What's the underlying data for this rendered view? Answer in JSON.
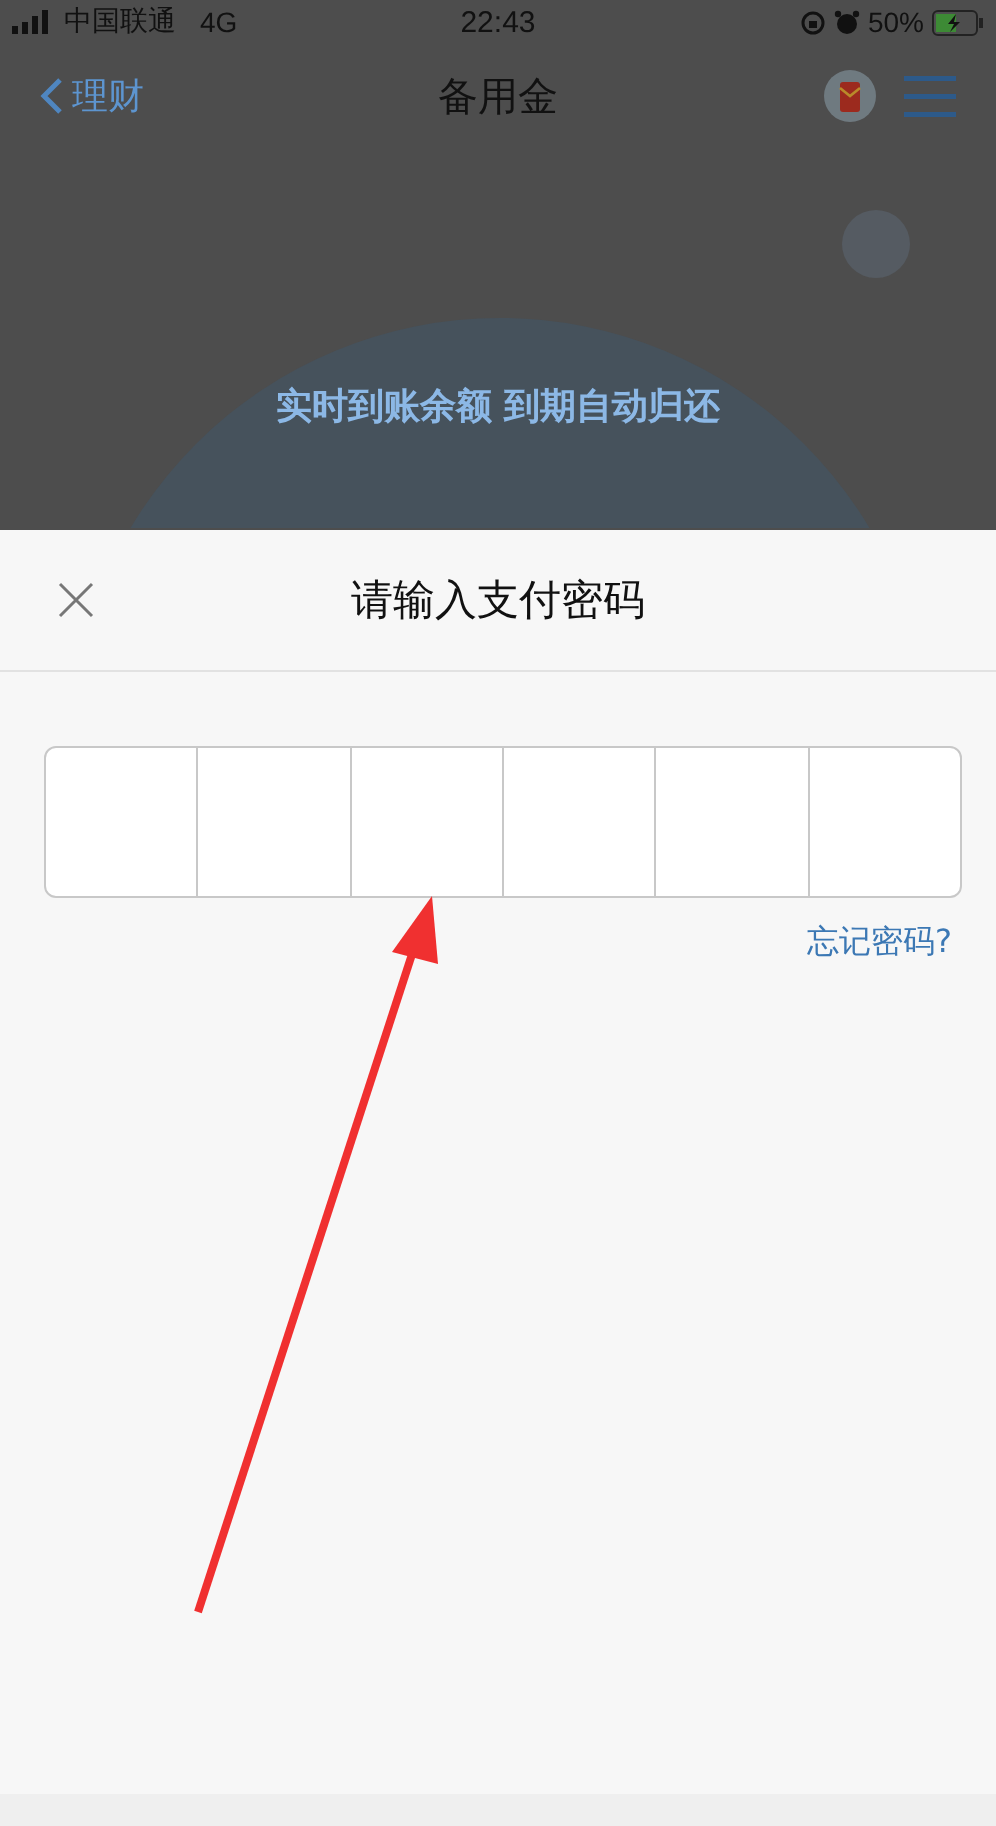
{
  "status_bar": {
    "carrier": "中国联通",
    "network": "4G",
    "time": "22:43",
    "battery": "50%"
  },
  "nav": {
    "back": "理财",
    "title": "备用金"
  },
  "page": {
    "tagline": "实时到账余额 到期自动归还"
  },
  "sheet": {
    "title": "请输入支付密码",
    "digits": [
      {
        "filled": false
      },
      {
        "filled": false
      },
      {
        "filled": false
      },
      {
        "filled": false
      },
      {
        "filled": false
      },
      {
        "filled": false
      }
    ],
    "forgot": "忘记密码?"
  }
}
